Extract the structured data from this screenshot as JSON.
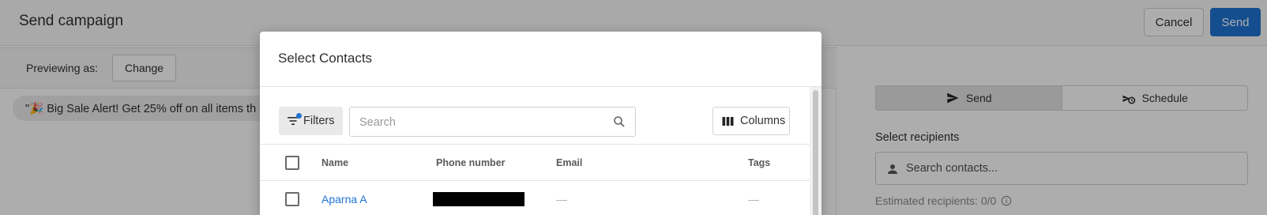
{
  "page": {
    "title": "Send campaign",
    "cancel_label": "Cancel",
    "send_label": "Send"
  },
  "preview": {
    "label": "Previewing as:",
    "change_label": "Change",
    "message_snippet": "\"🎉 Big Sale Alert! Get 25% off on all items th"
  },
  "right": {
    "tabs": [
      {
        "label": "Send",
        "icon": "paper-plane-icon",
        "active": true
      },
      {
        "label": "Schedule",
        "icon": "scheduled-send-icon",
        "active": false
      }
    ],
    "select_recipients_label": "Select recipients",
    "search_placeholder": "Search contacts...",
    "estimate_text": "Estimated recipients: 0/0"
  },
  "modal": {
    "title": "Select Contacts",
    "filters_label": "Filters",
    "search_placeholder": "Search",
    "columns_label": "Columns",
    "table": {
      "headers": [
        "Name",
        "Phone number",
        "Email",
        "Tags"
      ],
      "rows": [
        {
          "name": "Aparna A",
          "phone": "",
          "email": "—",
          "tags": "—"
        }
      ]
    }
  },
  "colors": {
    "primary": "#1f74d3",
    "overlay": "rgba(0,0,0,0.32)"
  }
}
